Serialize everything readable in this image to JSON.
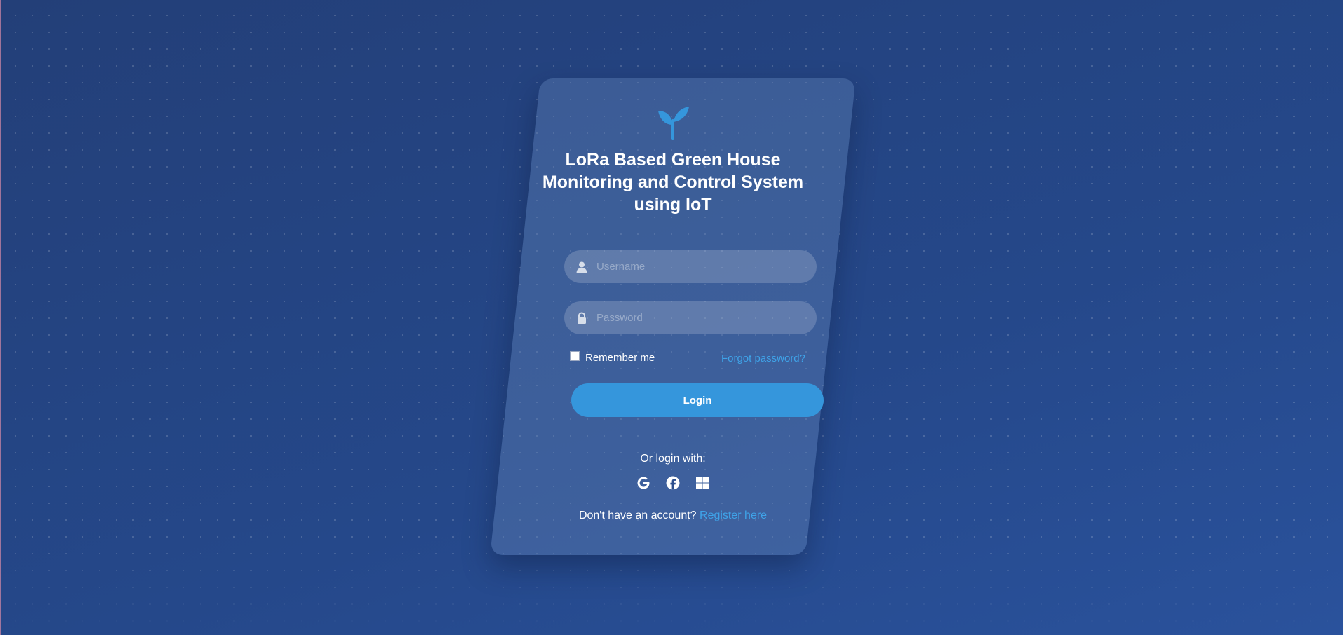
{
  "app": {
    "title": "LoRa Based Green House Monitoring and Control System using IoT"
  },
  "icons": {
    "logo": "seedling-icon",
    "username": "user-icon",
    "password": "lock-icon",
    "google": "google-icon",
    "facebook": "facebook-icon",
    "microsoft": "windows-icon"
  },
  "form": {
    "username_placeholder": "Username",
    "username_value": "",
    "password_placeholder": "Password",
    "password_value": "",
    "remember_label": "Remember me",
    "remember_checked": false,
    "forgot_label": "Forgot password?",
    "login_label": "Login"
  },
  "social": {
    "prompt": "Or login with:"
  },
  "register": {
    "prompt": "Don't have an account?",
    "link_label": "Register here"
  },
  "colors": {
    "accent": "#3596dc",
    "link": "#3fa3e8",
    "background": "#25488a"
  }
}
